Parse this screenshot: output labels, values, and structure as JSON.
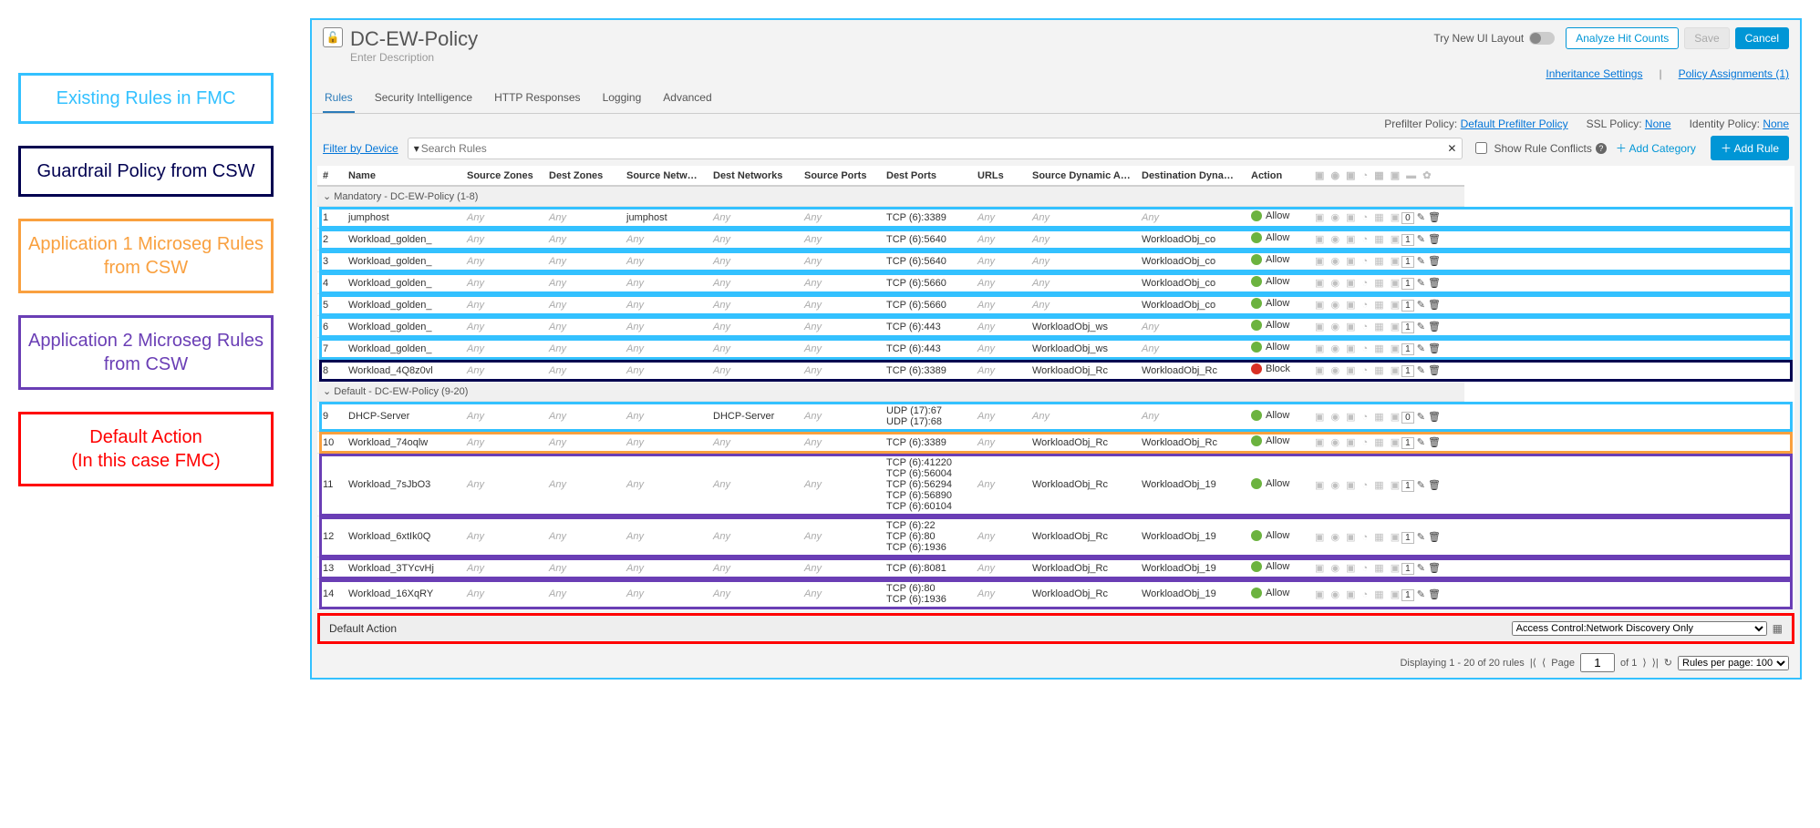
{
  "legend": {
    "fmc": "Existing Rules in FMC",
    "guard": "Guardrail Policy from CSW",
    "app1": "Application 1 Microseg Rules from CSW",
    "app2": "Application 2 Microseg Rules from CSW",
    "def": "Default Action\n(In this case FMC)"
  },
  "header": {
    "title": "DC-EW-Policy",
    "desc": "Enter Description",
    "try": "Try New UI Layout",
    "analyze": "Analyze Hit Counts",
    "save": "Save",
    "cancel": "Cancel"
  },
  "row2": {
    "inh": "Inheritance Settings",
    "pa": "Policy Assignments (1)"
  },
  "tabs": [
    "Rules",
    "Security Intelligence",
    "HTTP Responses",
    "Logging",
    "Advanced"
  ],
  "tabright": {
    "pfl": "Prefilter Policy:",
    "pfv": "Default Prefilter Policy",
    "ssll": "SSL Policy:",
    "sslv": "None",
    "idl": "Identity Policy:",
    "idv": "None"
  },
  "filter": {
    "fbd": "Filter by Device",
    "ph": "Search Rules",
    "conf": "Show Rule Conflicts",
    "addcat": "Add Category",
    "addrule": "Add Rule"
  },
  "cols": [
    "#",
    "Name",
    "Source Zones",
    "Dest Zones",
    "Source Networks",
    "Dest Networks",
    "Source Ports",
    "Dest Ports",
    "URLs",
    "Source Dynamic Attributes",
    "Destination Dynamic Attributes",
    "Action"
  ],
  "sections": [
    {
      "title": "Mandatory - DC-EW-Policy (1-8)",
      "rows": [
        {
          "n": "1",
          "name": "jumphost",
          "sn": "jumphost",
          "dp": "TCP (6):3389",
          "act": "Allow",
          "cnt": "0",
          "hl": "fmc"
        },
        {
          "n": "2",
          "name": "Workload_golden_",
          "dp": "TCP (6):5640",
          "dda": "WorkloadObj_co",
          "act": "Allow",
          "cnt": "1",
          "hl": "fmc"
        },
        {
          "n": "3",
          "name": "Workload_golden_",
          "dp": "TCP (6):5640",
          "dda": "WorkloadObj_co",
          "act": "Allow",
          "cnt": "1",
          "hl": "fmc"
        },
        {
          "n": "4",
          "name": "Workload_golden_",
          "dp": "TCP (6):5660",
          "dda": "WorkloadObj_co",
          "act": "Allow",
          "cnt": "1",
          "hl": "fmc"
        },
        {
          "n": "5",
          "name": "Workload_golden_",
          "dp": "TCP (6):5660",
          "dda": "WorkloadObj_co",
          "act": "Allow",
          "cnt": "1",
          "hl": "fmc"
        },
        {
          "n": "6",
          "name": "Workload_golden_",
          "dp": "TCP (6):443",
          "sda": "WorkloadObj_ws",
          "act": "Allow",
          "cnt": "1",
          "hl": "fmc"
        },
        {
          "n": "7",
          "name": "Workload_golden_",
          "dp": "TCP (6):443",
          "sda": "WorkloadObj_ws",
          "act": "Allow",
          "cnt": "1",
          "hl": "fmc"
        },
        {
          "n": "8",
          "name": "Workload_4Q8z0vl",
          "dp": "TCP (6):3389",
          "sda": "WorkloadObj_Rc",
          "dda": "WorkloadObj_Rc",
          "act": "Block",
          "cnt": "1",
          "hl": "guard"
        }
      ]
    },
    {
      "title": "Default - DC-EW-Policy (9-20)",
      "rows": [
        {
          "n": "9",
          "name": "DHCP-Server",
          "dn": "DHCP-Server",
          "dp": "UDP (17):67\nUDP (17):68",
          "act": "Allow",
          "cnt": "0",
          "hl": "fmc"
        },
        {
          "n": "10",
          "name": "Workload_74oqlw",
          "dp": "TCP (6):3389",
          "sda": "WorkloadObj_Rc",
          "dda": "WorkloadObj_Rc",
          "act": "Allow",
          "cnt": "1",
          "hl": "app1"
        },
        {
          "n": "11",
          "name": "Workload_7sJbO3",
          "dp": "TCP (6):41220\nTCP (6):56004\nTCP (6):56294\nTCP (6):56890\nTCP (6):60104",
          "sda": "WorkloadObj_Rc",
          "dda": "WorkloadObj_19",
          "act": "Allow",
          "cnt": "1",
          "hl": "app2"
        },
        {
          "n": "12",
          "name": "Workload_6xtIk0Q",
          "dp": "TCP (6):22\nTCP (6):80\nTCP (6):1936",
          "sda": "WorkloadObj_Rc",
          "dda": "WorkloadObj_19",
          "act": "Allow",
          "cnt": "1",
          "hl": "app2"
        },
        {
          "n": "13",
          "name": "Workload_3TYcvHj",
          "dp": "TCP (6):8081",
          "sda": "WorkloadObj_Rc",
          "dda": "WorkloadObj_19",
          "act": "Allow",
          "cnt": "1",
          "hl": "app2"
        },
        {
          "n": "14",
          "name": "Workload_16XqRY",
          "dp": "TCP (6):80\nTCP (6):1936",
          "sda": "WorkloadObj_Rc",
          "dda": "WorkloadObj_19",
          "act": "Allow",
          "cnt": "1",
          "hl": "app2"
        }
      ]
    }
  ],
  "default": {
    "label": "Default Action",
    "value": "Access Control:Network Discovery Only"
  },
  "pager": {
    "disp": "Displaying 1 - 20 of 20 rules",
    "page": "Page",
    "pv": "1",
    "of": "of 1",
    "rpp": "Rules per page: 100"
  },
  "hlcolors": {
    "fmc": "#33c1ff",
    "guard": "#000050",
    "app1": "#f9a03f",
    "app2": "#6a3eb5"
  }
}
